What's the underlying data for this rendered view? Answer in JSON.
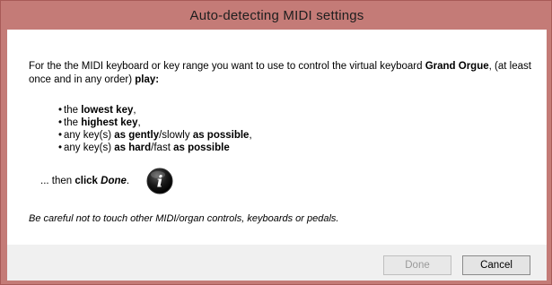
{
  "window": {
    "title": "Auto-detecting MIDI settings"
  },
  "instructions": {
    "intro_1": "For the the MIDI keyboard or key range you want to use to control the virtual keyboard ",
    "intro_bold_organ": "Grand Orgue",
    "intro_2": ", (at least once and in any order) ",
    "intro_bold_play": "play:",
    "bullets": [
      {
        "pre": "the ",
        "bold": "lowest key",
        "post": ",",
        "bold2": "",
        "post2": ""
      },
      {
        "pre": "the ",
        "bold": "highest key",
        "post": ",",
        "bold2": "",
        "post2": ""
      },
      {
        "pre": "any key(s) ",
        "bold": "as gently",
        "post": "/slowly ",
        "bold2": "as possible",
        "post2": ","
      },
      {
        "pre": "any key(s) ",
        "bold": "as hard",
        "post": "/fast ",
        "bold2": "as possible",
        "post2": ""
      }
    ],
    "bullet_char": "•",
    "then_pre": "... then ",
    "then_bold": "click ",
    "then_bold_italic": "Done",
    "then_post": ".",
    "info_icon_glyph": "i",
    "warning": "Be careful not to touch other MIDI/organ controls, keyboards or pedals."
  },
  "buttons": {
    "done_label": "Done",
    "cancel_label": "Cancel"
  },
  "colors": {
    "frame": "#c47b77",
    "footer": "#f0f0f0"
  }
}
